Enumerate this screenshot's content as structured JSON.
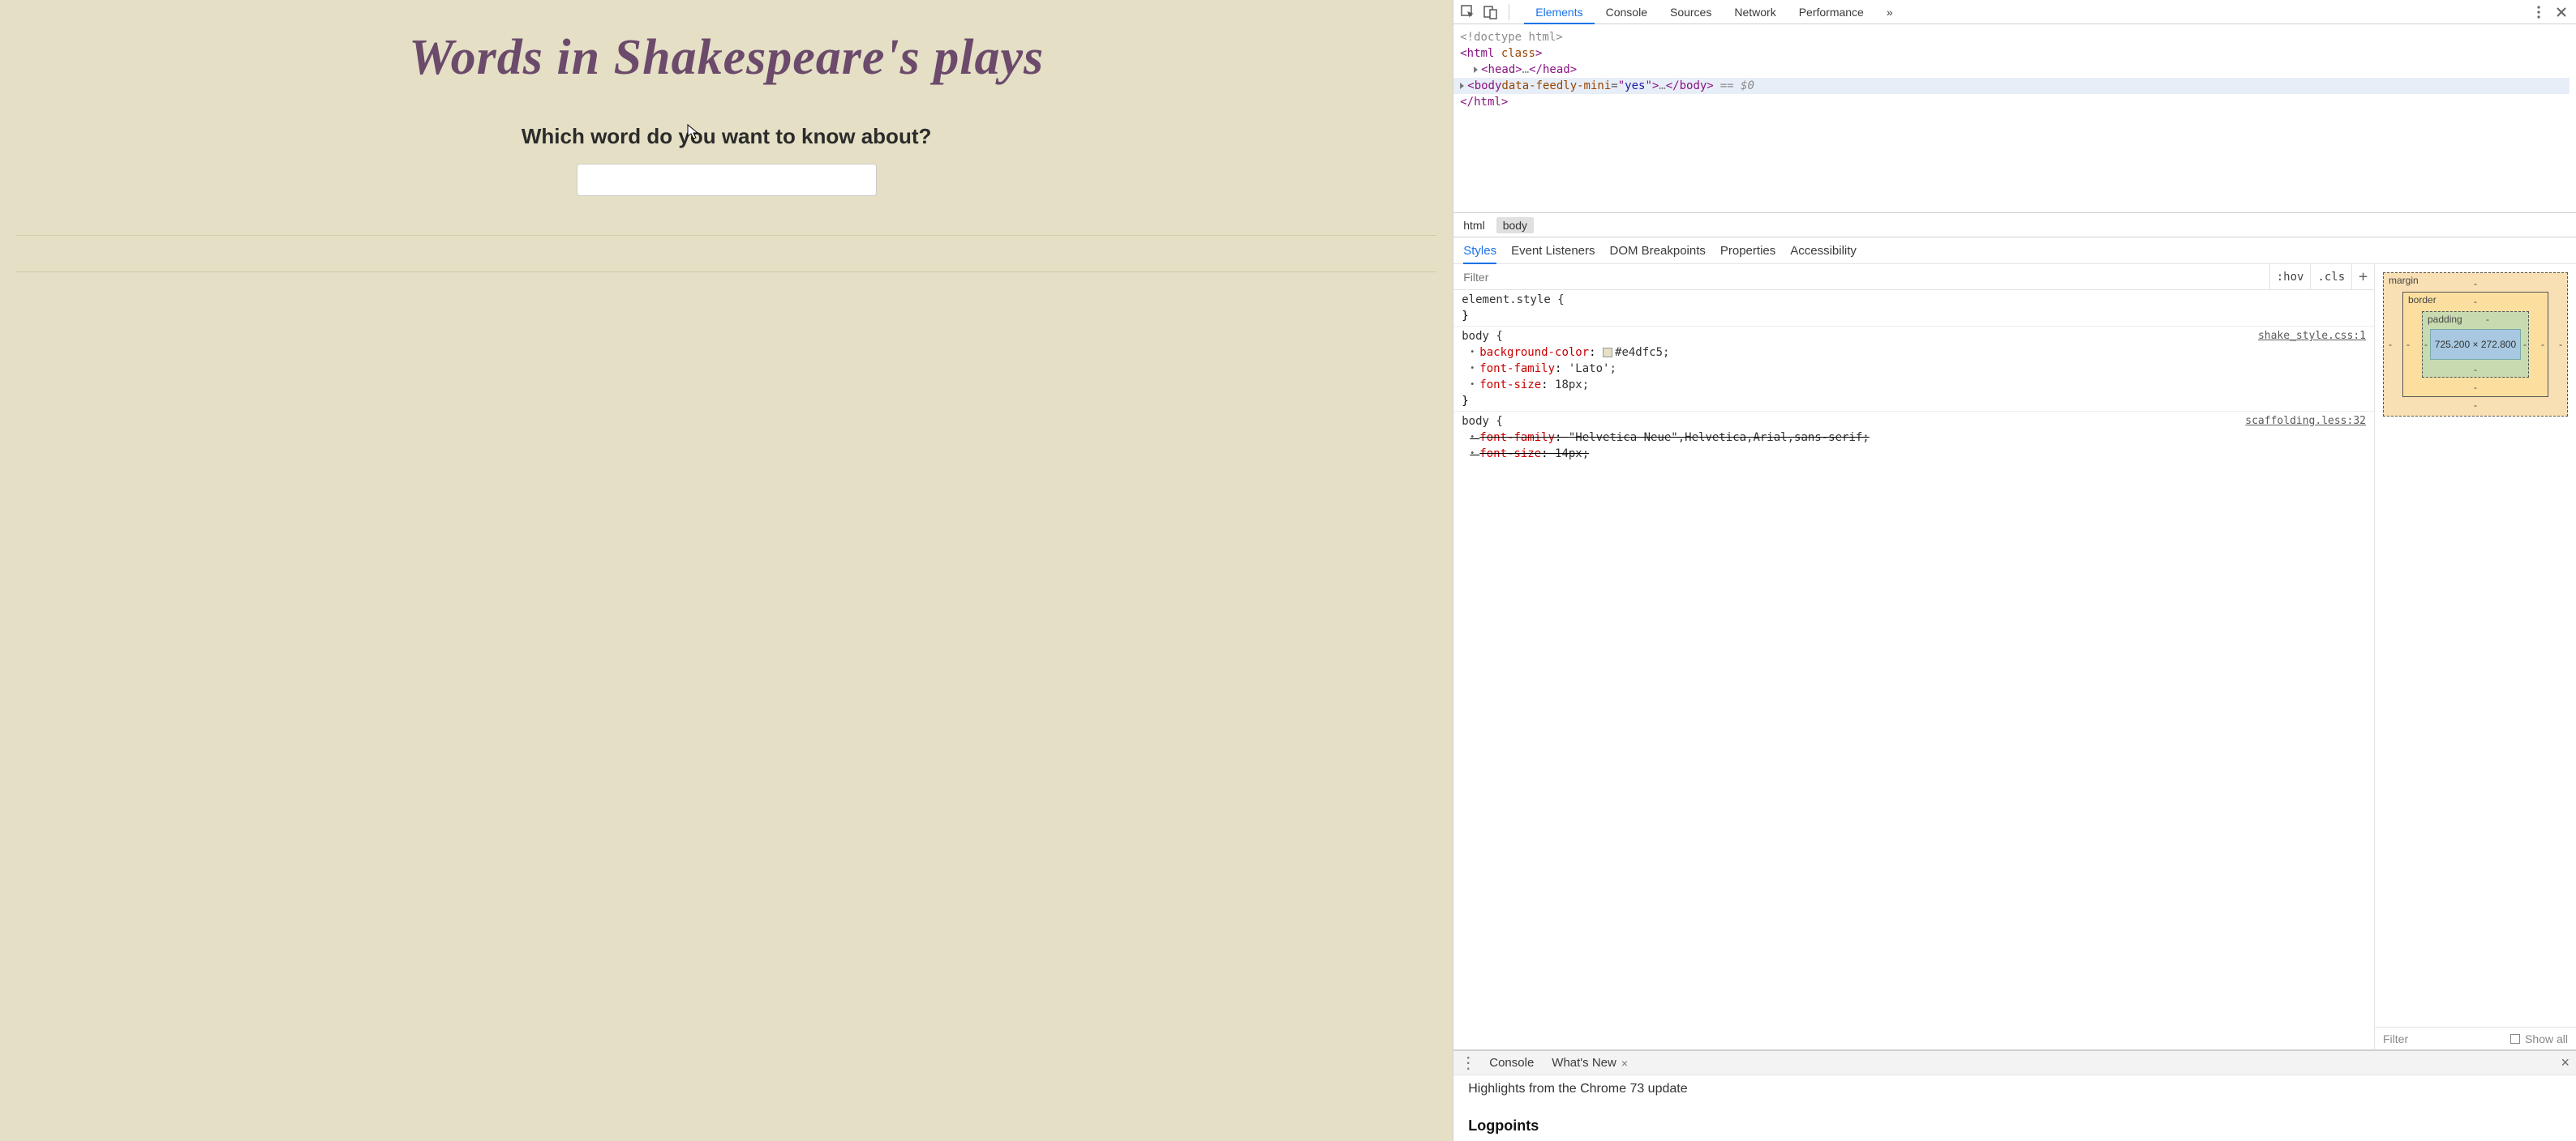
{
  "page": {
    "title": "Words in Shakespeare's plays",
    "question": "Which word do you want to know about?",
    "input_value": ""
  },
  "devtools": {
    "top_tabs": [
      "Elements",
      "Console",
      "Sources",
      "Network",
      "Performance"
    ],
    "active_top_tab": "Elements",
    "overflow_icon": "»",
    "dom": {
      "doctype": "<!doctype html>",
      "html_open": "<html class>",
      "head_collapsed": "<head>…</head>",
      "body_line": {
        "tag": "body",
        "attr_name": "data-feedly-mini",
        "attr_value": "yes",
        "ellipsis": "…",
        "close": "</body>",
        "annotation": "== $0"
      },
      "html_close": "</html>"
    },
    "crumbs": [
      "html",
      "body"
    ],
    "active_crumb": "body",
    "sub_tabs": [
      "Styles",
      "Event Listeners",
      "DOM Breakpoints",
      "Properties",
      "Accessibility"
    ],
    "active_sub_tab": "Styles",
    "filter_placeholder": "Filter",
    "hov_label": ":hov",
    "cls_label": ".cls",
    "rules": {
      "r0": {
        "selector": "element.style {"
      },
      "r1": {
        "selector": "body {",
        "source": "shake_style.css:1",
        "p1_name": "background-color",
        "p1_val": "#e4dfc5;",
        "p2_name": "font-family",
        "p2_val": "'Lato';",
        "p3_name": "font-size",
        "p3_val": "18px;"
      },
      "r2": {
        "selector": "body {",
        "source": "scaffolding.less:32",
        "p1_name": "font-family",
        "p1_val": "\"Helvetica Neue\",Helvetica,Arial,sans-serif;",
        "p2_name": "font-size",
        "p2_val": "14px;"
      }
    },
    "box_model": {
      "margin_label": "margin",
      "border_label": "border",
      "padding_label": "padding",
      "content_dims": "725.200 × 272.800",
      "dash": "-"
    },
    "computed_filter_placeholder": "Filter",
    "computed_showall": "Show all",
    "drawer": {
      "tab1": "Console",
      "tab2": "What's New",
      "highlights": "Highlights from the Chrome 73 update",
      "logpoints": "Logpoints"
    }
  }
}
